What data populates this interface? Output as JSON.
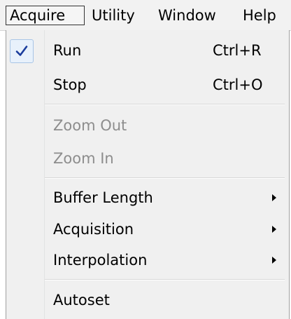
{
  "menubar": {
    "items": [
      {
        "label": "Acquire",
        "active": true
      },
      {
        "label": "Utility"
      },
      {
        "label": "Window"
      },
      {
        "label": "Help"
      }
    ]
  },
  "dropdown": {
    "items": [
      {
        "label": "Run",
        "shortcut": "Ctrl+R",
        "checked": true,
        "icon": "checkmark-icon"
      },
      {
        "label": "Stop",
        "shortcut": "Ctrl+O"
      },
      {
        "label": "Zoom Out",
        "disabled": true
      },
      {
        "label": "Zoom In",
        "disabled": true
      },
      {
        "label": "Buffer Length",
        "submenu": true
      },
      {
        "label": "Acquisition",
        "submenu": true
      },
      {
        "label": "Interpolation",
        "submenu": true
      },
      {
        "label": "Autoset"
      }
    ]
  },
  "colors": {
    "menu_background": "#f0f0f0",
    "disabled_text": "#8d8d8d",
    "check_color": "#1a3c9c",
    "check_highlight": "#e8f1fb"
  }
}
